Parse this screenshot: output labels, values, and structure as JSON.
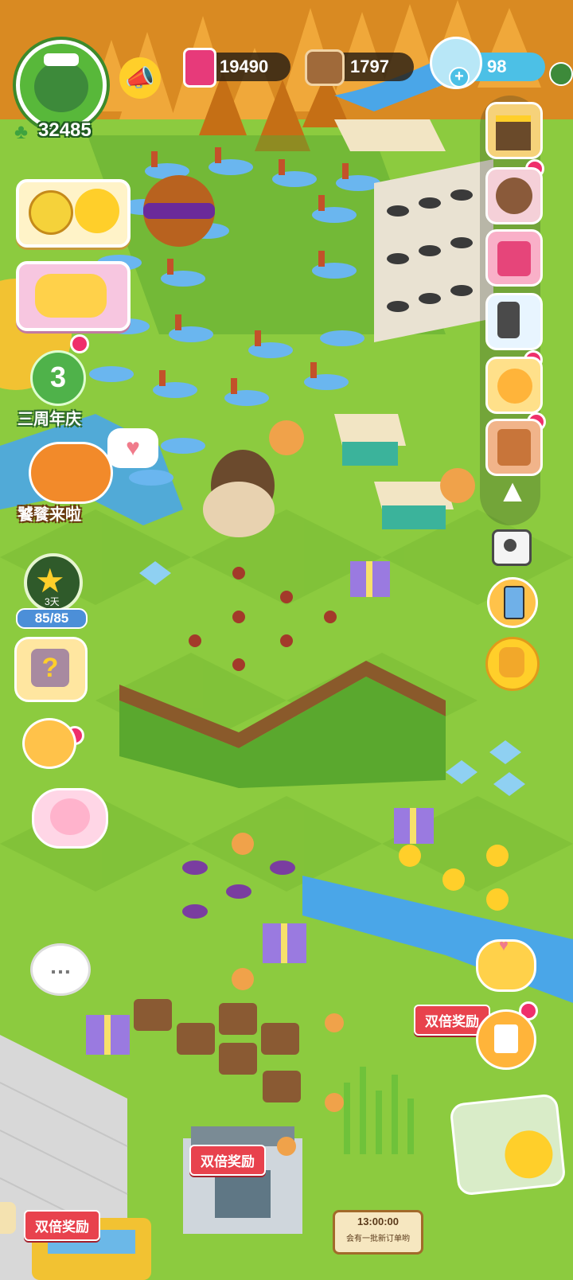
{
  "hud": {
    "level_clover_count": "32485",
    "jam": "19490",
    "wood": "1797",
    "gems": "98"
  },
  "left_menu": {
    "anniversary_number": "3",
    "anniversary_label": "三周年庆",
    "event_label": "饕餮来啦",
    "star_progress": "85/85",
    "star_tag": "3天"
  },
  "right_menu": {
    "double_reward": "双倍奖励"
  },
  "bottom": {
    "double_reward_a": "双倍奖励",
    "double_reward_b": "双倍奖励",
    "timer": "13:00:00",
    "order_text": "会有一批新订单哟"
  },
  "colors": {
    "grass_light": "#a5d84a",
    "grass_dark": "#4f9a2b",
    "water": "#4aa6e8",
    "autumn_tree": "#e89a2a",
    "accent_red": "#e8424d"
  }
}
